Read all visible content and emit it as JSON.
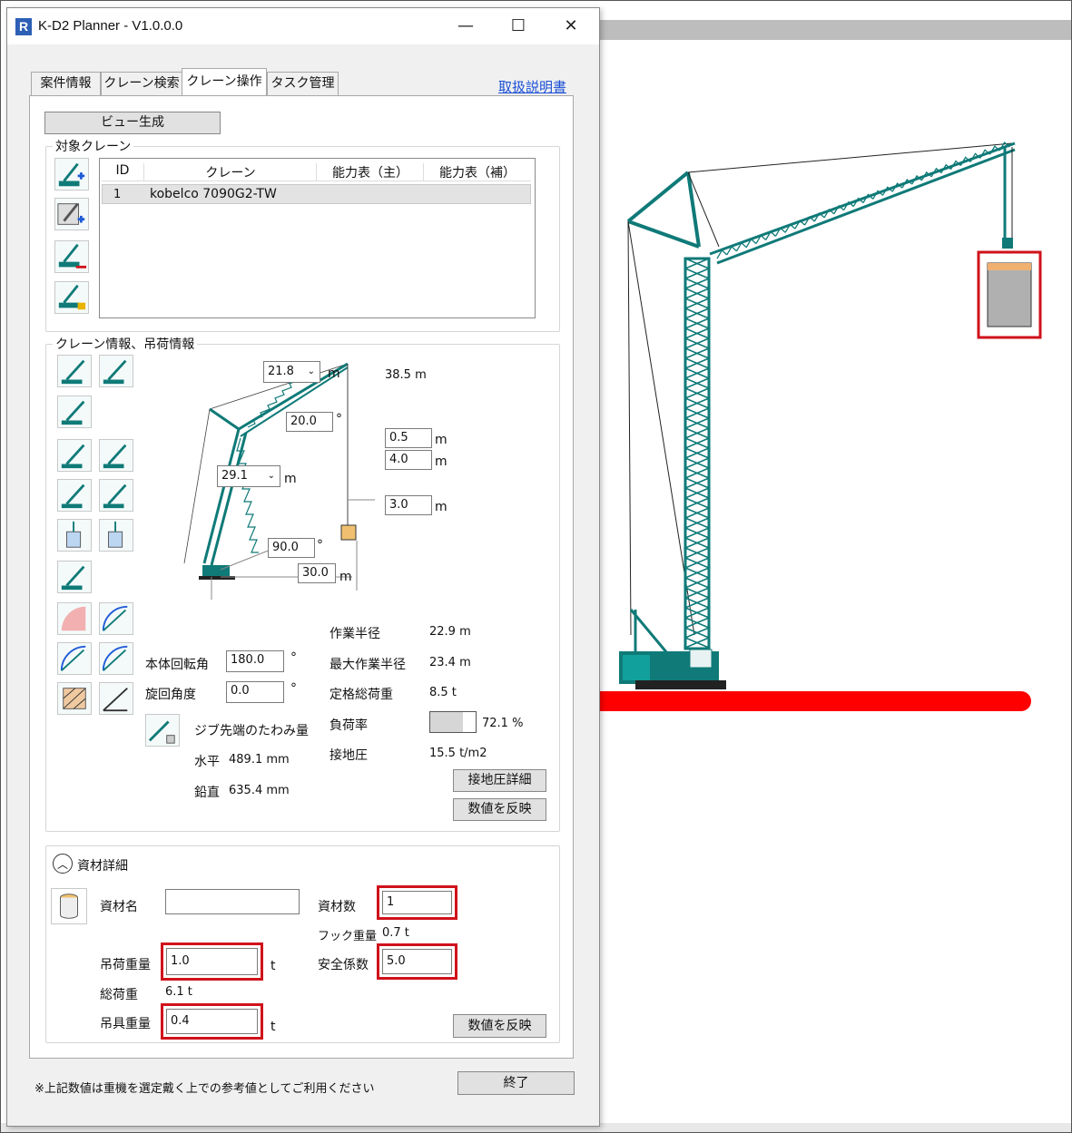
{
  "window": {
    "title": "K-D2 Planner - V1.0.0.0",
    "app_icon_letter": "R",
    "controls": {
      "minimize": "—",
      "maximize": "☐",
      "close": "✕"
    }
  },
  "tabs": [
    {
      "label": "案件情報",
      "active": false
    },
    {
      "label": "クレーン検索",
      "active": false
    },
    {
      "label": "クレーン操作",
      "active": true
    },
    {
      "label": "タスク管理",
      "active": false
    }
  ],
  "manual_link": "取扱説明書",
  "view_button": "ビュー生成",
  "target_crane": {
    "group_label": "対象クレーン",
    "columns": [
      "ID",
      "クレーン",
      "能力表（主）",
      "能力表（補）"
    ],
    "rows": [
      {
        "id": "1",
        "crane": "kobelco 7090G2-TW",
        "main": "",
        "aux": ""
      }
    ]
  },
  "crane_info": {
    "group_label": "クレーン情報、吊荷情報",
    "diagram": {
      "jib_length": "21.8",
      "jib_unit": "m",
      "total_height": "38.5 m",
      "jib_angle": "20.0",
      "deg": "°",
      "hook_a": "0.5",
      "hook_b": "4.0",
      "hook_c": "3.0",
      "m": "m",
      "boom_length": "29.1",
      "boom_angle": "90.0",
      "radius": "30.0"
    },
    "body_rotation_label": "本体回転角",
    "body_rotation_value": "180.0",
    "swing_angle_label": "旋回角度",
    "swing_angle_value": "0.0",
    "deflection_label": "ジブ先端のたわみ量",
    "horizontal_label": "水平",
    "horizontal_value": "489.1 mm",
    "vertical_label": "鉛直",
    "vertical_value": "635.4 mm",
    "stats": [
      {
        "label": "作業半径",
        "value": "22.9 m"
      },
      {
        "label": "最大作業半径",
        "value": "23.4 m"
      },
      {
        "label": "定格総荷重",
        "value": "8.5 t"
      },
      {
        "label": "負荷率",
        "value": "72.1 %"
      },
      {
        "label": "接地圧",
        "value": "15.5 t/m2"
      }
    ],
    "load_rate": 0.721,
    "ground_pressure_button": "接地圧詳細",
    "apply_button": "数値を反映"
  },
  "material": {
    "header": "資材詳細",
    "chevron": "︿",
    "name_label": "資材名",
    "name_value": "",
    "count_label": "資材数",
    "count_value": "1",
    "hook_weight_label": "フック重量",
    "hook_weight_value": "0.7 t",
    "load_weight_label": "吊荷重量",
    "load_weight_value": "1.0",
    "safety_label": "安全係数",
    "safety_value": "5.0",
    "total_label": "総荷重",
    "total_value": "6.1 t",
    "rigging_label": "吊具重量",
    "rigging_value": "0.4",
    "unit_t": "t",
    "apply_button": "数値を反映"
  },
  "footer_note": "※上記数値は重機を選定戴く上での参考値としてご利用ください",
  "exit_button": "終了",
  "colors": {
    "crane": "#0f7a78",
    "highlight": "#d0121b",
    "ground": "#ff0000",
    "load_top": "#f0b070",
    "load_body": "#b0b0b0"
  }
}
